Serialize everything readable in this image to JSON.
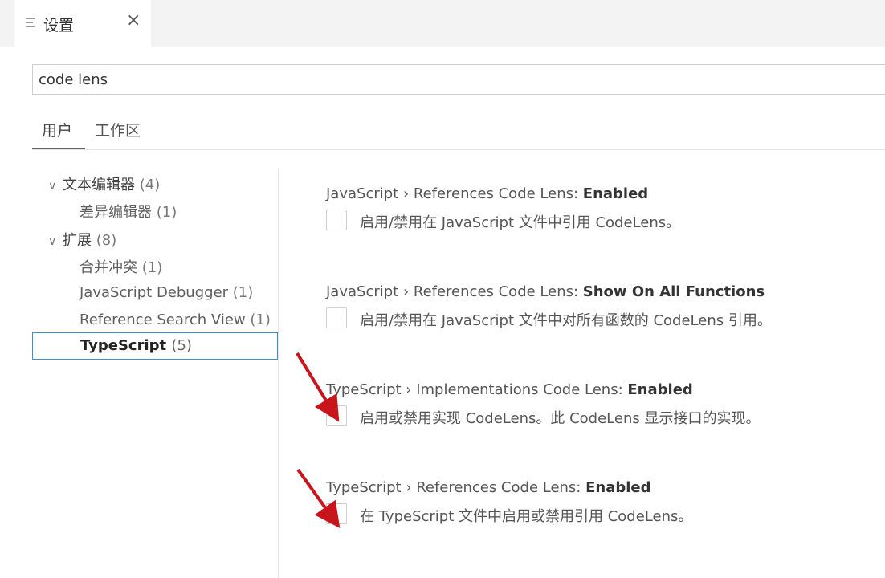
{
  "tabbar": {
    "tab_title": "设置",
    "close_glyph": "×"
  },
  "search": {
    "value": "code lens"
  },
  "scope_tabs": {
    "user": "用户",
    "workspace": "工作区"
  },
  "toc": {
    "items": [
      {
        "label": "文本编辑器",
        "count": "(4)",
        "expanded": true
      },
      {
        "label": "差异编辑器",
        "count": "(1)"
      },
      {
        "label": "扩展",
        "count": "(8)",
        "expanded": true
      },
      {
        "label": "合并冲突",
        "count": "(1)"
      },
      {
        "label": "JavaScript Debugger",
        "count": "(1)"
      },
      {
        "label": "Reference Search View",
        "count": "(1)"
      },
      {
        "label": "TypeScript",
        "count": "(5)",
        "selected": true
      }
    ]
  },
  "settings": [
    {
      "category": "JavaScript › References Code Lens: ",
      "key": "Enabled",
      "description": "启用/禁用在 JavaScript 文件中引用 CodeLens。",
      "checked": false
    },
    {
      "category": "JavaScript › References Code Lens: ",
      "key": "Show On All Functions",
      "description": "启用/禁用在 JavaScript 文件中对所有函数的 CodeLens 引用。",
      "checked": false
    },
    {
      "category": "TypeScript › Implementations Code Lens: ",
      "key": "Enabled",
      "description": "启用或禁用实现 CodeLens。此 CodeLens 显示接口的实现。",
      "checked": false
    },
    {
      "category": "TypeScript › References Code Lens: ",
      "key": "Enabled",
      "description": "在 TypeScript 文件中启用或禁用引用 CodeLens。",
      "checked": false
    }
  ],
  "colors": {
    "accent_border": "#3d8fd6",
    "annotation_arrow": "#c8141b"
  }
}
